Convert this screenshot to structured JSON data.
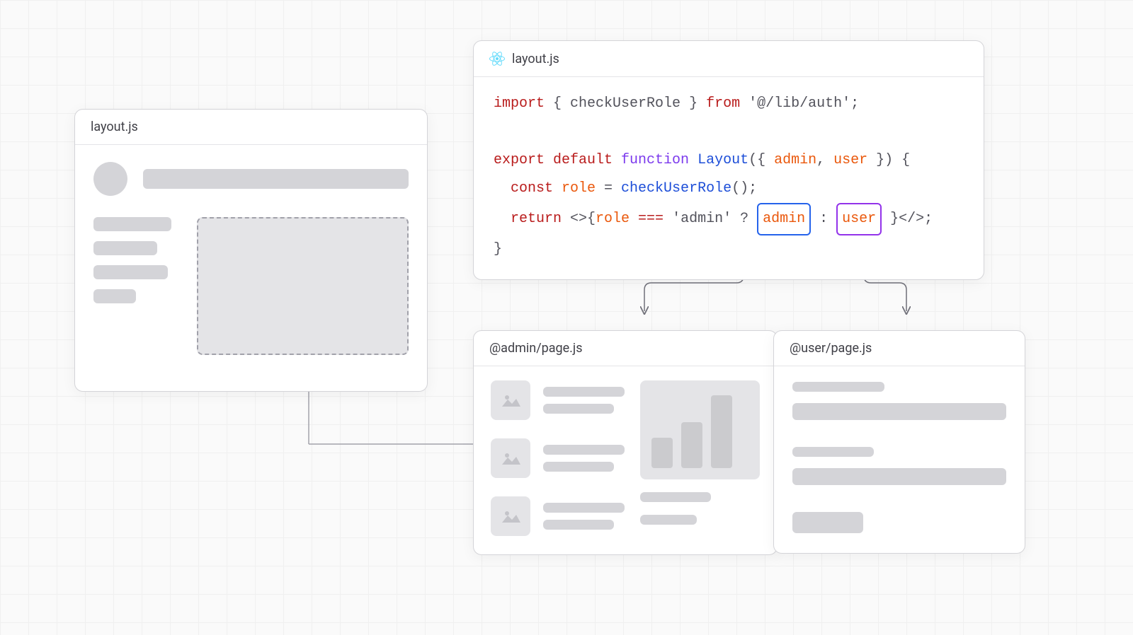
{
  "panels": {
    "layout_wire": {
      "title": "layout.js"
    },
    "code": {
      "title": "layout.js",
      "tokens": {
        "import": "import",
        "lbrace1": " { ",
        "checkUserRole": "checkUserRole",
        "rbrace1": " } ",
        "from": "from",
        "path": " '@/lib/auth'",
        "semi": ";",
        "export": "export",
        "default": " default",
        "function": " function",
        "layout_fn": " Layout",
        "params_open": "({ ",
        "admin_param": "admin",
        "comma_sp": ", ",
        "user_param": "user",
        "params_close": " }) {",
        "const": "  const",
        "role": " role",
        "eq": " = ",
        "call": "checkUserRole",
        "paren": "();",
        "return": "  return",
        "jsx_open": " <>{",
        "role2": "role",
        "triple_eq": " === ",
        "admin_str": "'admin'",
        "q": " ? ",
        "admin_chip": "admin",
        "colon": " : ",
        "user_chip": "user",
        "jsx_close": " }</>;",
        "close_brace": "}"
      }
    },
    "admin": {
      "title": "@admin/page.js"
    },
    "user": {
      "title": "@user/page.js"
    }
  }
}
